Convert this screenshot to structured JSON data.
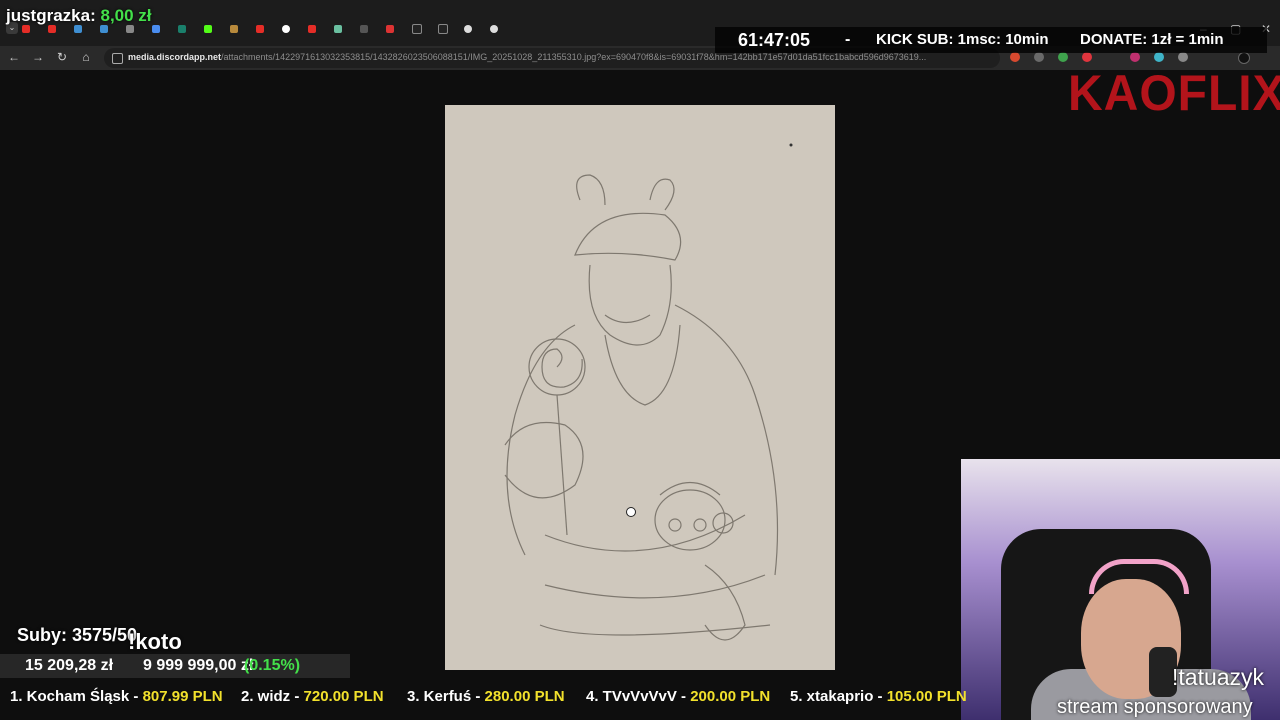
{
  "browser": {
    "url_main": "media.discordapp.net",
    "url_path": "/attachments/1422971613032353815/1432826023506088151/IMG_20251028_211355310.jpg?ex=690470f8&is=69031f78&hm=142bb171e57d01da51fcc1babcd596d9673619..."
  },
  "overlay": {
    "donor_name": "justgrazka:",
    "donor_amount": "8,00 zł",
    "timer": "61:47:05",
    "dash": "-",
    "kick_sub": "KICK SUB: 1msc: 10min",
    "donate": "DONATE: 1zł = 1min",
    "brand": "KAOFLIX",
    "subs": "Suby: 3575/50",
    "koto": "!koto",
    "goal_current": "15 209,28 zł",
    "goal_target": "9 999 999,00 zł",
    "goal_percent": "(0.15%)",
    "tatuazyk": "!tatuazyk",
    "sponsored": "stream sponsorowany"
  },
  "ticker": [
    {
      "label": "1. Kocham Śląsk - ",
      "value": "807.99 PLN"
    },
    {
      "label": "2. widz - ",
      "value": "720.00 PLN"
    },
    {
      "label": "3. Kerfuś - ",
      "value": "280.00 PLN"
    },
    {
      "label": "4. TVvVvVvV - ",
      "value": "200.00 PLN"
    },
    {
      "label": "5. xtakaprio - ",
      "value": "105.00 PLN"
    }
  ]
}
